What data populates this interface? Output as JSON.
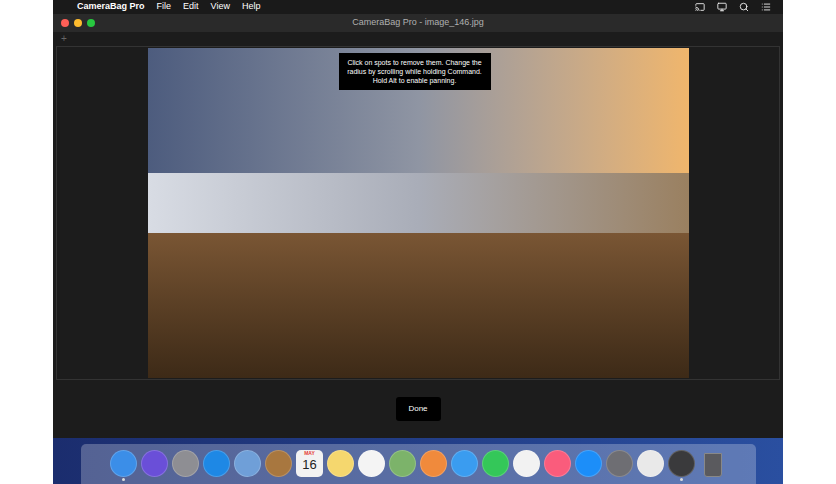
{
  "menubar": {
    "apple": "",
    "app": "CameraBag Pro",
    "menus": [
      "File",
      "Edit",
      "View",
      "Help"
    ]
  },
  "window": {
    "title": "CameraBag Pro - image_146.jpg"
  },
  "toolbar": {
    "add": "+"
  },
  "tooltip": "Click on spots to remove them. Change the radius by scrolling while holding Command. Hold Alt to enable panning.",
  "buttons": [
    "Done"
  ],
  "dock": {
    "items": [
      {
        "kind": "app",
        "color": "#3b8ee8",
        "running": true
      },
      {
        "kind": "app",
        "color": "#6a4fd8",
        "running": false
      },
      {
        "kind": "app",
        "color": "#8e8e93",
        "running": false
      },
      {
        "kind": "app",
        "color": "#1e88e5",
        "running": false
      },
      {
        "kind": "app",
        "color": "#6f9fd8",
        "running": false
      },
      {
        "kind": "app",
        "color": "#a8773f",
        "running": false
      },
      {
        "kind": "calendar",
        "color": "#f2f2f2",
        "month": "MAY",
        "day": "16",
        "running": false
      },
      {
        "kind": "app",
        "color": "#f5d76e",
        "running": false
      },
      {
        "kind": "app",
        "color": "#f4f4f4",
        "running": false
      },
      {
        "kind": "app",
        "color": "#7cb36a",
        "running": false
      },
      {
        "kind": "app",
        "color": "#f08a3c",
        "running": false
      },
      {
        "kind": "app",
        "color": "#3a9cf0",
        "running": false
      },
      {
        "kind": "app",
        "color": "#34c759",
        "running": false
      },
      {
        "kind": "app",
        "color": "#f2f2f2",
        "running": false
      },
      {
        "kind": "app",
        "color": "#fa5c7c",
        "running": false
      },
      {
        "kind": "app",
        "color": "#1c8ef9",
        "running": false
      },
      {
        "kind": "app",
        "color": "#6e6e73",
        "running": false
      },
      {
        "kind": "app",
        "color": "#e9e9e9",
        "running": false
      },
      {
        "kind": "app",
        "color": "#3a3a3c",
        "running": true
      },
      {
        "kind": "trash",
        "color": "#5a5a5e",
        "running": false
      }
    ]
  }
}
